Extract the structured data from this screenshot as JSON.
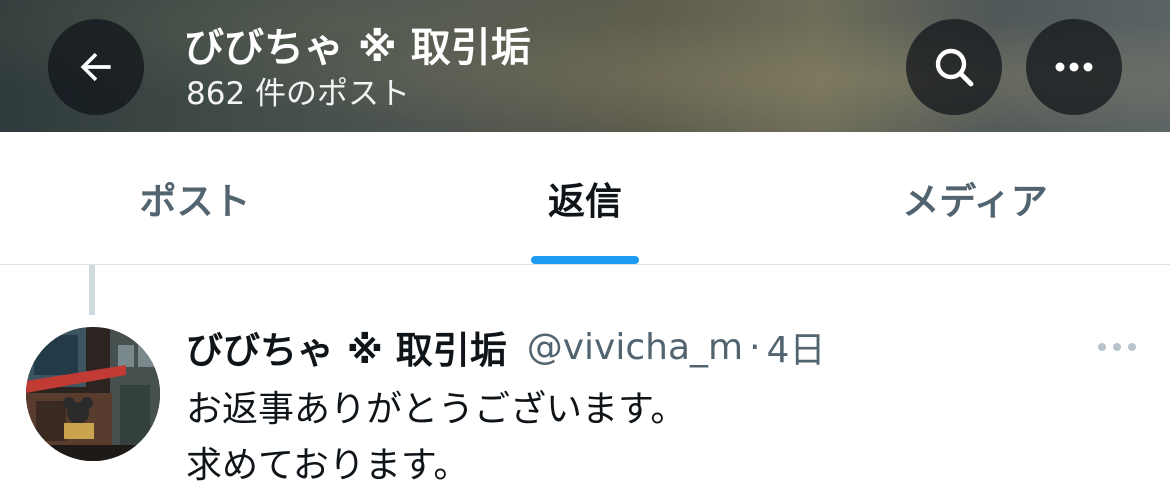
{
  "header": {
    "title": "びびちゃ ※ 取引垢",
    "subtitle": "862 件のポスト",
    "back_icon": "back-arrow-icon",
    "search_icon": "search-icon",
    "more_icon": "more-horizontal-icon"
  },
  "tabs": [
    {
      "label": "ポスト",
      "active": false
    },
    {
      "label": "返信",
      "active": true
    },
    {
      "label": "メディア",
      "active": false
    }
  ],
  "tweet": {
    "display_name": "びびちゃ ※ 取引垢",
    "handle": "@vivicha_m",
    "separator": "·",
    "time": "4日",
    "lines": [
      "お返事ありがとうございます。",
      "求めております。"
    ]
  },
  "colors": {
    "accent": "#1d9bf0",
    "text_primary": "#0f1419",
    "text_secondary": "#536471"
  }
}
